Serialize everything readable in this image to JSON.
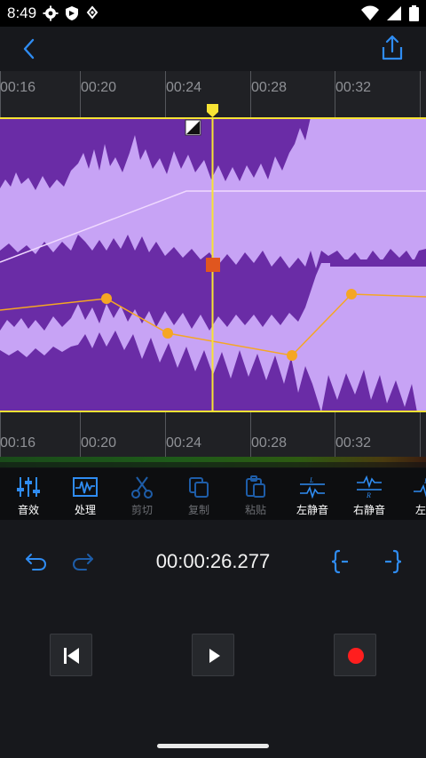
{
  "status_bar": {
    "time": "8:49",
    "left_icons": [
      "settings-icon",
      "shield-icon",
      "download-icon"
    ],
    "right_icons": [
      "wifi-icon",
      "signal-icon",
      "battery-icon"
    ]
  },
  "topbar": {
    "back_icon": "chevron-left-icon",
    "share_icon": "share-icon"
  },
  "ruler_top": {
    "ticks": [
      "00:16",
      "00:20",
      "00:24",
      "00:28",
      "00:32"
    ]
  },
  "ruler_bottom": {
    "ticks": [
      "00:16",
      "00:20",
      "00:24",
      "00:28",
      "00:32"
    ]
  },
  "waveform": {
    "background_color": "#3d2c7f",
    "wave_color": "#c7a3f5",
    "playhead_color": "#f7e334",
    "volume_envelope_color": "#f5a623",
    "fade_line_color": "#f0d9ff"
  },
  "toolbar": {
    "items": [
      {
        "label": "音效",
        "icon": "equalizer-icon",
        "enabled": true
      },
      {
        "label": "处理",
        "icon": "waveform-process-icon",
        "enabled": true
      },
      {
        "label": "剪切",
        "icon": "scissors-icon",
        "enabled": false
      },
      {
        "label": "复制",
        "icon": "copy-icon",
        "enabled": false
      },
      {
        "label": "粘贴",
        "icon": "paste-icon",
        "enabled": false
      },
      {
        "label": "左静音",
        "icon": "left-mute-icon",
        "enabled": true
      },
      {
        "label": "右静音",
        "icon": "right-mute-icon",
        "enabled": true
      },
      {
        "label": "左横",
        "icon": "left-right-icon",
        "enabled": true
      }
    ]
  },
  "controls": {
    "time": "00:00:26.277",
    "undo_icon": "undo-icon",
    "redo_icon": "redo-icon",
    "mark_start_icon": "bracket-start-icon",
    "mark_end_icon": "bracket-end-icon",
    "skip_back_icon": "skip-to-start-icon",
    "play_icon": "play-icon",
    "record_icon": "record-icon",
    "accent_color": "#2f8cf2",
    "record_color": "#ff1e1e"
  }
}
